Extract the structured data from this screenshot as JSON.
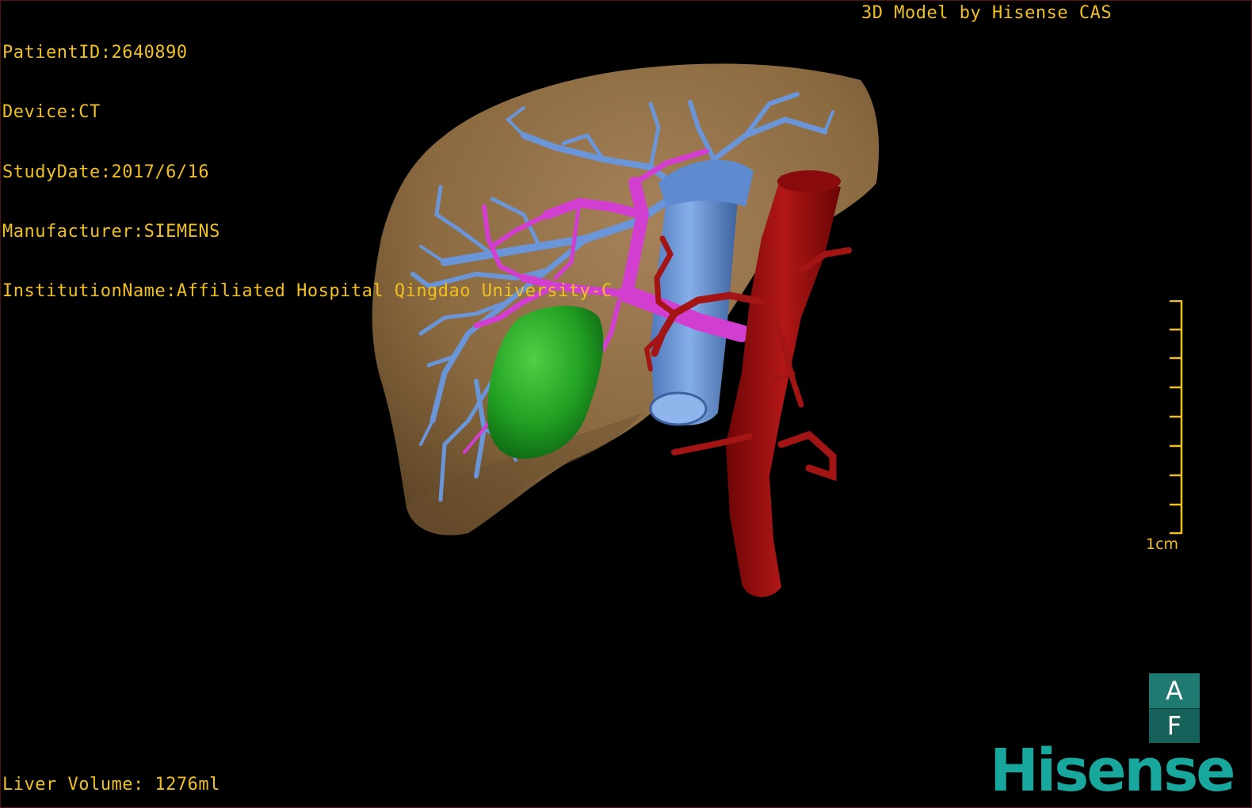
{
  "patient_info": {
    "patient_id": "PatientID:2640890",
    "device": "Device:CT",
    "study_date": "StudyDate:2017/6/16",
    "manufacturer": "Manufacturer:SIEMENS",
    "institution": "InstitutionName:Affiliated Hospital Qingdao University-C"
  },
  "model_credit": "3D Model by Hisense CAS",
  "liver_volume": "Liver Volume: 1276ml",
  "scale": {
    "label": "1cm"
  },
  "orientation_cube": {
    "top_face": "A",
    "bottom_face": "F"
  },
  "brand_logo": "Hisense",
  "colors": {
    "overlay_text": "#f0c020",
    "liver": "#8b6a40",
    "hepatic_vein": "#6a95d8",
    "portal_vein": "#d23fd0",
    "artery": "#a31414",
    "lesion": "#21a023",
    "brand": "#17a79d"
  }
}
